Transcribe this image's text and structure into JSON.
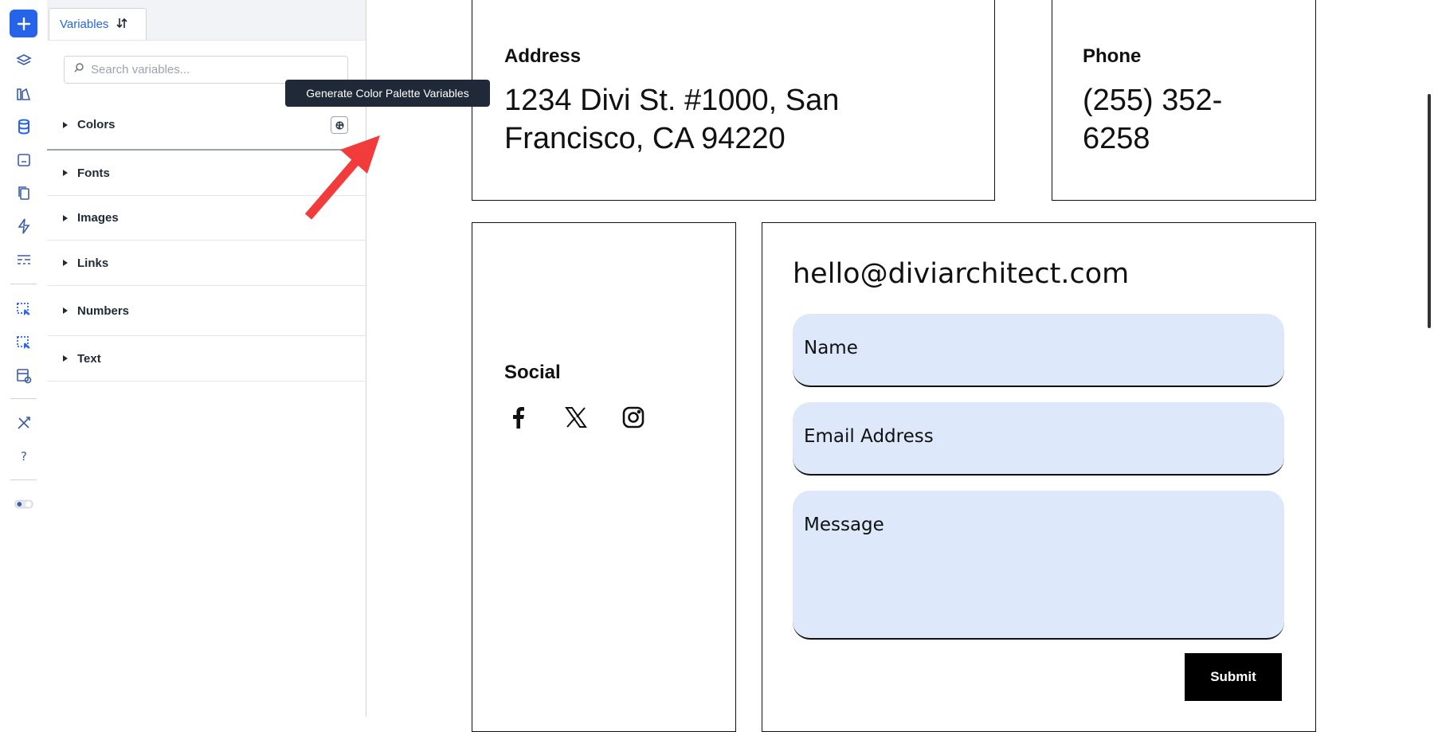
{
  "panel": {
    "tab_label": "Variables",
    "search_placeholder": "Search variables...",
    "categories": [
      {
        "label": "Colors"
      },
      {
        "label": "Fonts"
      },
      {
        "label": "Images"
      },
      {
        "label": "Links"
      },
      {
        "label": "Numbers"
      },
      {
        "label": "Text"
      }
    ],
    "tooltip": "Generate Color Palette Variables"
  },
  "page": {
    "address_label": "Address",
    "address_value": "1234 Divi St. #1000, San Francisco, CA 94220",
    "phone_label": "Phone",
    "phone_value": "(255) 352-6258",
    "social_label": "Social",
    "social_icons": [
      "facebook-icon",
      "x-icon",
      "instagram-icon"
    ],
    "email": "hello@diviarchitect.com",
    "form": {
      "name_placeholder": "Name",
      "email_placeholder": "Email Address",
      "message_placeholder": "Message",
      "submit_label": "Submit"
    }
  },
  "colors": {
    "accent": "#2563eb",
    "field_bg": "#dde8fb",
    "tooltip_bg": "#1f2937",
    "arrow": "#f23b3b"
  }
}
